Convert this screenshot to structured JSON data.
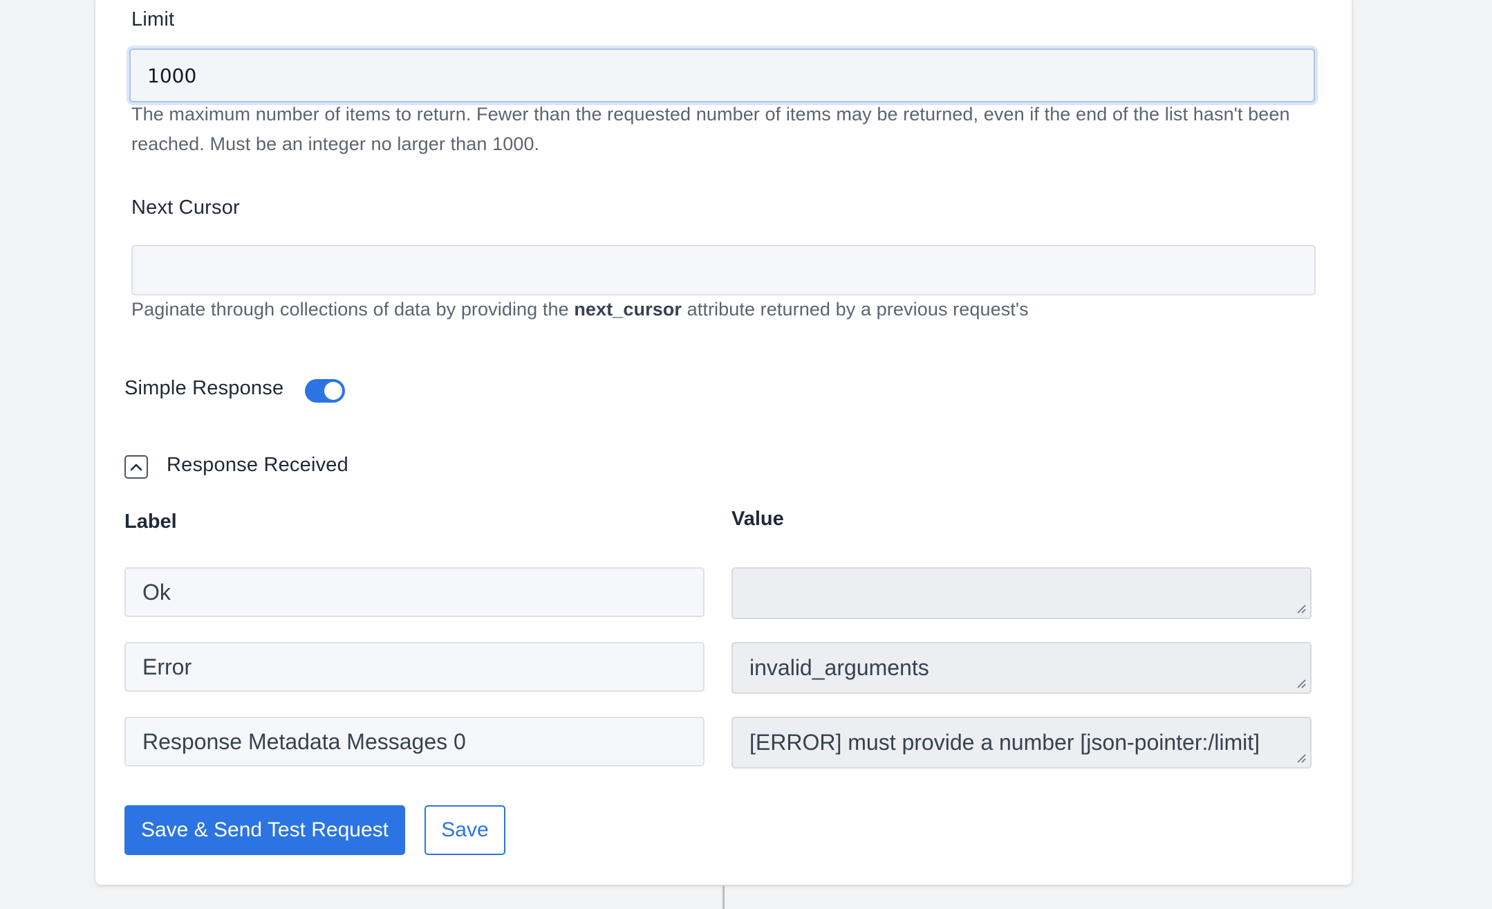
{
  "limit": {
    "label": "Limit",
    "value": "1000",
    "help": "The maximum number of items to return. Fewer than the requested number of items may be returned, even if the end of the list hasn't been reached. Must be an integer no larger than 1000."
  },
  "next_cursor": {
    "label": "Next Cursor",
    "value": "",
    "help_prefix": "Paginate through collections of data by providing the",
    "help_bold": "next_cursor",
    "help_suffix": "attribute returned by a previous request's"
  },
  "simple_response": {
    "label": "Simple Response",
    "enabled": true
  },
  "response_received": {
    "title": "Response Received",
    "label_header": "Label",
    "value_header": "Value",
    "rows": [
      {
        "label": "Ok",
        "value": ""
      },
      {
        "label": "Error",
        "value": "invalid_arguments"
      },
      {
        "label": "Response Metadata Messages 0",
        "value": "[ERROR] must provide a number [json-pointer:/limit]"
      }
    ]
  },
  "actions": {
    "save_send_label": "Save & Send Test Request",
    "save_label": "Save"
  },
  "colors": {
    "accent": "#2b74e2"
  }
}
